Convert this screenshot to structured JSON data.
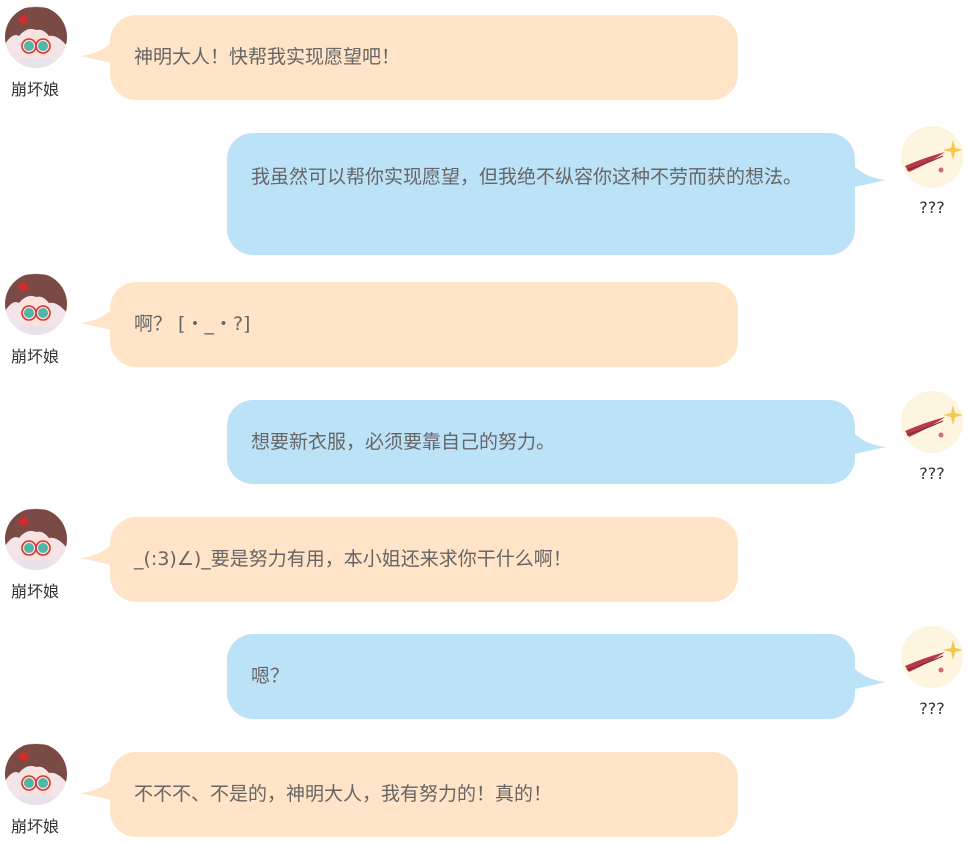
{
  "colors": {
    "left_bubble": "#ffe4c7",
    "right_bubble": "#bce2f8",
    "text": "#666666",
    "name_text": "#333333"
  },
  "characters": {
    "girl": {
      "name": "崩坏娘",
      "avatar_icon": "anime-girl-avatar-icon"
    },
    "god": {
      "name": "???",
      "avatar_icon": "deity-sparkle-avatar-icon"
    }
  },
  "messages": [
    {
      "side": "left",
      "speaker": "崩坏娘",
      "text": "神明大人！快帮我实现愿望吧！"
    },
    {
      "side": "right",
      "speaker": "???",
      "text": "我虽然可以帮你实现愿望，但我绝不纵容你这种不劳而获的想法。"
    },
    {
      "side": "left",
      "speaker": "崩坏娘",
      "text": "啊？ [・_・?]"
    },
    {
      "side": "right",
      "speaker": "???",
      "text": "想要新衣服，必须要靠自己的努力。"
    },
    {
      "side": "left",
      "speaker": "崩坏娘",
      "text": "_(:3)∠)_要是努力有用，本小姐还来求你干什么啊！"
    },
    {
      "side": "right",
      "speaker": "???",
      "text": "嗯？"
    },
    {
      "side": "left",
      "speaker": "崩坏娘",
      "text": "不不不、不是的，神明大人，我有努力的！真的！"
    }
  ]
}
